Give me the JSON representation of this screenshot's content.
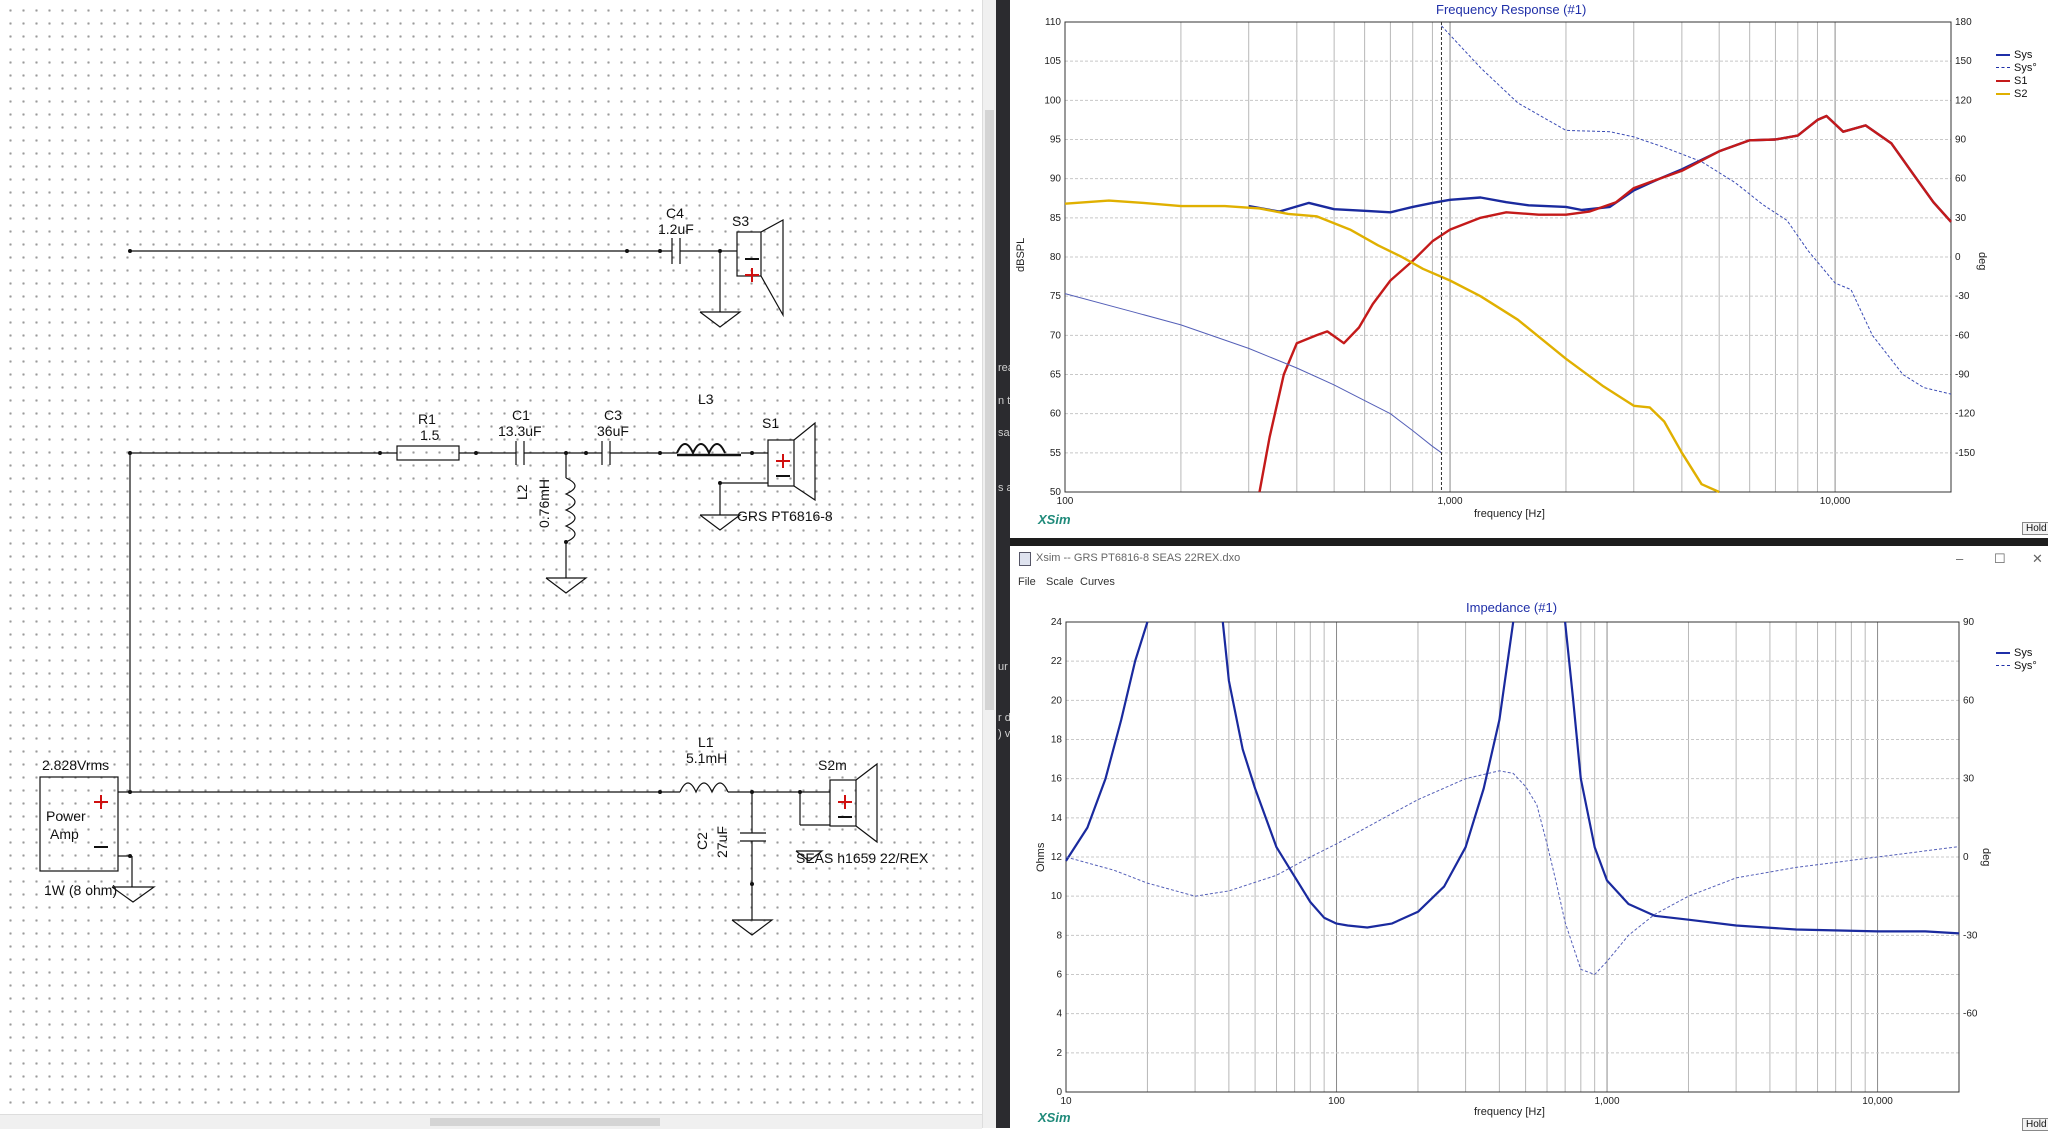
{
  "schematic": {
    "components": {
      "c4": {
        "name": "C4",
        "value": "1.2uF"
      },
      "s3": {
        "name": "S3"
      },
      "r1": {
        "name": "R1",
        "value": "1.5"
      },
      "c1": {
        "name": "C1",
        "value": "13.3uF"
      },
      "c3": {
        "name": "C3",
        "value": "36uF"
      },
      "l3": {
        "name": "L3"
      },
      "s1": {
        "name": "S1",
        "driver": "GRS PT6816-8"
      },
      "l2": {
        "name": "L2",
        "value": "0.76mH"
      },
      "l1": {
        "name": "L1",
        "value": "5.1mH"
      },
      "c2": {
        "name": "C2",
        "value": "27uF"
      },
      "s2m": {
        "name": "S2m",
        "driver": "SEAS h1659 22/REX"
      },
      "amp": {
        "voltage": "2.828Vrms",
        "label_line1": "Power",
        "label_line2": "Amp",
        "power": "1W (8 ohm)"
      }
    }
  },
  "side_strip": {
    "fragments": [
      "rea",
      "n t",
      "sa",
      "s a",
      "ur",
      "r d",
      ") v"
    ]
  },
  "frequency_response": {
    "title": "Frequency Response (#1)",
    "y_left_label": "dBSPL",
    "y_right_label": "deg",
    "x_label": "frequency [Hz]",
    "watermark": "XSim",
    "hold_label": "Hold",
    "legend": [
      {
        "name": "Sys",
        "color": "#1f2fa8",
        "style": "solid"
      },
      {
        "name": "Sys°",
        "color": "#1f2fa8",
        "style": "dashed"
      },
      {
        "name": "S1",
        "color": "#c41a1a",
        "style": "solid"
      },
      {
        "name": "S2",
        "color": "#e0b000",
        "style": "solid"
      }
    ]
  },
  "impedance_window": {
    "titlebar": "Xsim -- GRS PT6816-8 SEAS 22REX.dxo",
    "menu": [
      "File",
      "Scale",
      "Curves"
    ],
    "controls": {
      "minimize": "–",
      "maximize": "☐",
      "close": "✕"
    }
  },
  "impedance": {
    "title": "Impedance (#1)",
    "y_left_label": "Ohms",
    "y_right_label": "deg",
    "x_label": "frequency [Hz]",
    "watermark": "XSim",
    "hold_label": "Hold",
    "legend": [
      {
        "name": "Sys",
        "color": "#1f2fa8",
        "style": "solid"
      },
      {
        "name": "Sys°",
        "color": "#1f2fa8",
        "style": "dashed"
      }
    ]
  },
  "chart_data": [
    {
      "type": "line",
      "title": "Frequency Response (#1)",
      "xlabel": "frequency [Hz]",
      "ylabel": "dBSPL",
      "y2label": "deg",
      "x_scale": "log",
      "xlim": [
        100,
        20000
      ],
      "ylim": [
        50,
        110
      ],
      "y2lim": [
        -180,
        180
      ],
      "x_tick_labels": [
        "100",
        "1,000",
        "10,000"
      ],
      "y_ticks": [
        50,
        55,
        60,
        65,
        70,
        75,
        80,
        85,
        90,
        95,
        100,
        105,
        110
      ],
      "y2_ticks": [
        -150,
        -120,
        -90,
        -60,
        -30,
        0,
        30,
        60,
        90,
        120,
        150,
        180
      ],
      "grid": true,
      "legend_position": "top-right",
      "series": [
        {
          "name": "Sys",
          "axis": "left",
          "points": [
            [
              300,
              86.5
            ],
            [
              360,
              85.8
            ],
            [
              430,
              86.9
            ],
            [
              500,
              86.1
            ],
            [
              600,
              85.9
            ],
            [
              700,
              85.7
            ],
            [
              800,
              86.4
            ],
            [
              900,
              86.9
            ],
            [
              1000,
              87.3
            ],
            [
              1200,
              87.6
            ],
            [
              1400,
              87.0
            ],
            [
              1600,
              86.6
            ],
            [
              2000,
              86.4
            ],
            [
              2200,
              86.0
            ],
            [
              2600,
              86.4
            ],
            [
              3000,
              88.5
            ],
            [
              3500,
              90.0
            ],
            [
              4000,
              91.2
            ],
            [
              5000,
              93.5
            ],
            [
              6000,
              94.9
            ],
            [
              7000,
              95.0
            ],
            [
              8000,
              95.5
            ],
            [
              9000,
              97.5
            ],
            [
              9500,
              98.0
            ],
            [
              10500,
              96.0
            ],
            [
              12000,
              96.8
            ],
            [
              14000,
              94.5
            ],
            [
              16000,
              90.5
            ],
            [
              18000,
              87.0
            ],
            [
              20000,
              84.5
            ]
          ]
        },
        {
          "name": "Sys°",
          "axis": "right",
          "points": [
            [
              950,
              177
            ],
            [
              1200,
              145
            ],
            [
              1500,
              118
            ],
            [
              2000,
              97
            ],
            [
              2600,
              96
            ],
            [
              3000,
              92
            ],
            [
              3600,
              84
            ],
            [
              4500,
              73
            ],
            [
              5500,
              57
            ],
            [
              6500,
              40
            ],
            [
              7500,
              28
            ],
            [
              8500,
              5
            ],
            [
              10000,
              -20
            ],
            [
              11000,
              -25
            ],
            [
              12500,
              -60
            ],
            [
              15000,
              -90
            ],
            [
              17000,
              -100
            ],
            [
              20000,
              -105
            ]
          ]
        },
        {
          "name": "S1",
          "axis": "left",
          "points": [
            [
              320,
              50
            ],
            [
              340,
              57
            ],
            [
              370,
              65
            ],
            [
              400,
              69
            ],
            [
              450,
              70
            ],
            [
              480,
              70.5
            ],
            [
              530,
              69
            ],
            [
              580,
              71
            ],
            [
              630,
              74
            ],
            [
              700,
              77
            ],
            [
              800,
              79.5
            ],
            [
              900,
              82
            ],
            [
              1000,
              83.5
            ],
            [
              1200,
              85
            ],
            [
              1400,
              85.7
            ],
            [
              1700,
              85.4
            ],
            [
              2000,
              85.4
            ],
            [
              2300,
              85.8
            ],
            [
              2700,
              87
            ],
            [
              3000,
              88.8
            ],
            [
              3500,
              90
            ],
            [
              4000,
              91
            ],
            [
              5000,
              93.5
            ],
            [
              6000,
              94.9
            ],
            [
              7000,
              95
            ],
            [
              8000,
              95.5
            ],
            [
              9000,
              97.5
            ],
            [
              9500,
              98
            ],
            [
              10500,
              96
            ],
            [
              12000,
              96.8
            ],
            [
              14000,
              94.5
            ],
            [
              16000,
              90.5
            ],
            [
              18000,
              87
            ],
            [
              20000,
              84.5
            ]
          ]
        },
        {
          "name": "S2",
          "axis": "left",
          "points": [
            [
              100,
              86.8
            ],
            [
              130,
              87.2
            ],
            [
              160,
              86.9
            ],
            [
              200,
              86.5
            ],
            [
              260,
              86.5
            ],
            [
              320,
              86.2
            ],
            [
              380,
              85.5
            ],
            [
              450,
              85.2
            ],
            [
              550,
              83.5
            ],
            [
              650,
              81.5
            ],
            [
              750,
              80
            ],
            [
              850,
              78.5
            ],
            [
              1000,
              77
            ],
            [
              1200,
              75
            ],
            [
              1500,
              72
            ],
            [
              2000,
              67
            ],
            [
              2500,
              63.5
            ],
            [
              3000,
              61
            ],
            [
              3300,
              60.8
            ],
            [
              3600,
              59
            ],
            [
              4000,
              55
            ],
            [
              4500,
              51
            ],
            [
              5000,
              50
            ]
          ]
        },
        {
          "name": "Sys°",
          "axis": "right",
          "points": [
            [
              100,
              -28
            ],
            [
              150,
              -42
            ],
            [
              200,
              -52
            ],
            [
              300,
              -70
            ],
            [
              400,
              -85
            ],
            [
              500,
              -98
            ],
            [
              600,
              -110
            ],
            [
              700,
              -120
            ],
            [
              800,
              -133
            ],
            [
              900,
              -145
            ],
            [
              950,
              -150
            ]
          ]
        }
      ]
    },
    {
      "type": "line",
      "title": "Impedance (#1)",
      "xlabel": "frequency [Hz]",
      "ylabel": "Ohms",
      "y2label": "deg",
      "x_scale": "log",
      "xlim": [
        10,
        20000
      ],
      "ylim": [
        0,
        24
      ],
      "y2lim": [
        -90,
        90
      ],
      "x_tick_labels": [
        "10",
        "100",
        "1,000",
        "10,000"
      ],
      "y_ticks": [
        0,
        2,
        4,
        6,
        8,
        10,
        12,
        14,
        16,
        18,
        20,
        22,
        24
      ],
      "y2_ticks": [
        -60,
        -30,
        0,
        30,
        60,
        90
      ],
      "grid": true,
      "legend_position": "top-right",
      "series": [
        {
          "name": "Sys",
          "axis": "left",
          "points": [
            [
              10,
              11.8
            ],
            [
              12,
              13.5
            ],
            [
              14,
              16
            ],
            [
              16,
              19
            ],
            [
              18,
              22
            ],
            [
              20,
              24
            ]
          ]
        },
        {
          "name": "Sys",
          "axis": "left",
          "points": [
            [
              38,
              24
            ],
            [
              40,
              21
            ],
            [
              45,
              17.5
            ],
            [
              50,
              15.5
            ],
            [
              60,
              12.5
            ],
            [
              70,
              11
            ],
            [
              80,
              9.7
            ],
            [
              90,
              8.9
            ],
            [
              100,
              8.6
            ],
            [
              110,
              8.5
            ],
            [
              130,
              8.4
            ],
            [
              160,
              8.6
            ],
            [
              200,
              9.2
            ],
            [
              250,
              10.5
            ],
            [
              300,
              12.5
            ],
            [
              350,
              15.5
            ],
            [
              400,
              19
            ],
            [
              450,
              24
            ]
          ]
        },
        {
          "name": "Sys",
          "axis": "left",
          "points": [
            [
              700,
              24
            ],
            [
              750,
              20
            ],
            [
              800,
              16
            ],
            [
              900,
              12.5
            ],
            [
              1000,
              10.8
            ],
            [
              1200,
              9.6
            ],
            [
              1500,
              9.0
            ],
            [
              2000,
              8.8
            ],
            [
              3000,
              8.5
            ],
            [
              5000,
              8.3
            ],
            [
              10000,
              8.2
            ],
            [
              15000,
              8.2
            ],
            [
              20000,
              8.1
            ]
          ]
        },
        {
          "name": "Sys°",
          "axis": "right",
          "points": [
            [
              10,
              0
            ],
            [
              15,
              -5
            ],
            [
              20,
              -10
            ],
            [
              30,
              -15
            ],
            [
              40,
              -13
            ],
            [
              60,
              -7
            ],
            [
              80,
              0
            ],
            [
              100,
              5
            ],
            [
              150,
              15
            ],
            [
              200,
              22
            ],
            [
              300,
              30
            ],
            [
              400,
              33
            ],
            [
              450,
              32
            ],
            [
              500,
              27
            ],
            [
              550,
              20
            ],
            [
              600,
              5
            ],
            [
              650,
              -10
            ],
            [
              700,
              -25
            ],
            [
              800,
              -43
            ],
            [
              900,
              -45
            ],
            [
              1000,
              -40
            ],
            [
              1200,
              -30
            ],
            [
              1500,
              -22
            ],
            [
              2000,
              -15
            ],
            [
              3000,
              -8
            ],
            [
              5000,
              -4
            ],
            [
              10000,
              0
            ],
            [
              20000,
              4
            ]
          ]
        }
      ]
    }
  ]
}
